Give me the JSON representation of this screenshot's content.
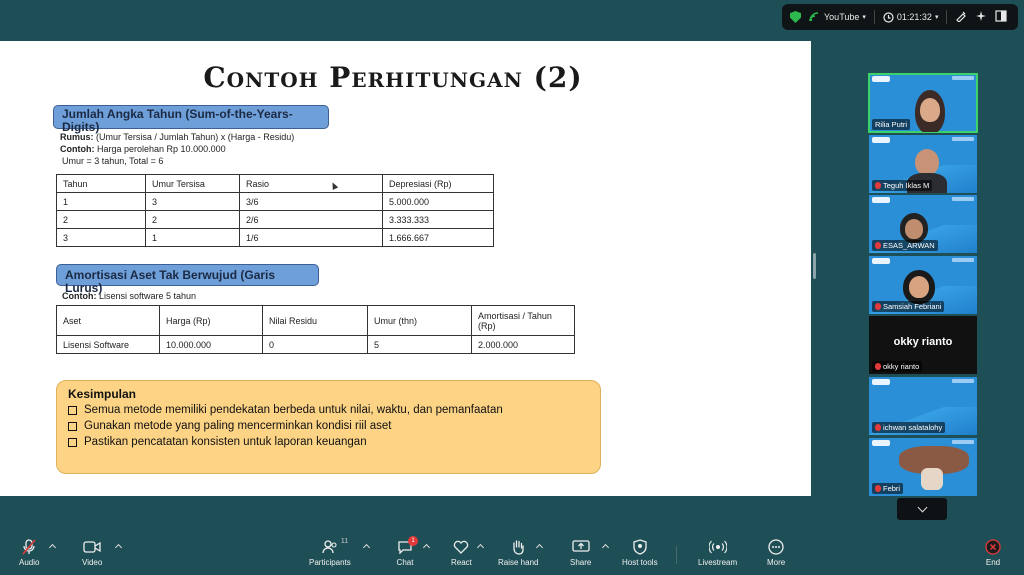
{
  "status": {
    "stream_label": "YouTube",
    "timer": "01:21:32"
  },
  "slide": {
    "title": "Contoh Perhitungan (2)",
    "section1": {
      "heading": "Jumlah Angka Tahun (Sum-of-the-Years-Digits)",
      "formula_label": "Rumus:",
      "formula": "(Umur Tersisa / Jumlah Tahun) x (Harga - Residu)",
      "example_label": "Contoh:",
      "example": "Harga perolehan Rp 10.000.000",
      "note": "Umur = 3 tahun, Total = 6",
      "headers": [
        "Tahun",
        "Umur Tersisa",
        "Rasio",
        "Depresiasi (Rp)"
      ],
      "rows": [
        [
          "1",
          "3",
          "3/6",
          "5.000.000"
        ],
        [
          "2",
          "2",
          "2/6",
          "3.333.333"
        ],
        [
          "3",
          "1",
          "1/6",
          "1.666.667"
        ]
      ]
    },
    "section2": {
      "heading": "Amortisasi Aset Tak Berwujud (Garis Lurus)",
      "example_label": "Contoh:",
      "example": "Lisensi software 5 tahun",
      "headers": [
        "Aset",
        "Harga (Rp)",
        "Nilai Residu",
        "Umur (thn)",
        "Amortisasi / Tahun (Rp)"
      ],
      "rows": [
        [
          "Lisensi Software",
          "10.000.000",
          "0",
          "5",
          "2.000.000"
        ]
      ]
    },
    "conclusion": {
      "title": "Kesimpulan",
      "items": [
        "Semua metode memiliki pendekatan berbeda untuk nilai, waktu, dan pemanfaatan",
        "Gunakan metode yang paling mencerminkan kondisi riil aset",
        "Pastikan pencatatan konsisten untuk laporan keuangan"
      ]
    }
  },
  "participants": [
    {
      "name": "Rilia Putri",
      "muted": false,
      "active": true
    },
    {
      "name": "Teguh Iklas M",
      "muted": true
    },
    {
      "name": "ESAS_ARWAN",
      "muted": true
    },
    {
      "name": "Samsiah Febriani",
      "muted": true
    },
    {
      "name": "okky rianto",
      "muted": true,
      "video_off": true
    },
    {
      "name": "ichwan salatalohy",
      "muted": true
    },
    {
      "name": "Febri",
      "muted": true
    }
  ],
  "toolbar": {
    "audio": "Audio",
    "video": "Video",
    "participants": "Participants",
    "participants_count": "11",
    "chat": "Chat",
    "chat_badge": "1",
    "react": "React",
    "raise_hand": "Raise hand",
    "share": "Share",
    "host_tools": "Host tools",
    "livestream": "Livestream",
    "more": "More",
    "end": "End"
  }
}
